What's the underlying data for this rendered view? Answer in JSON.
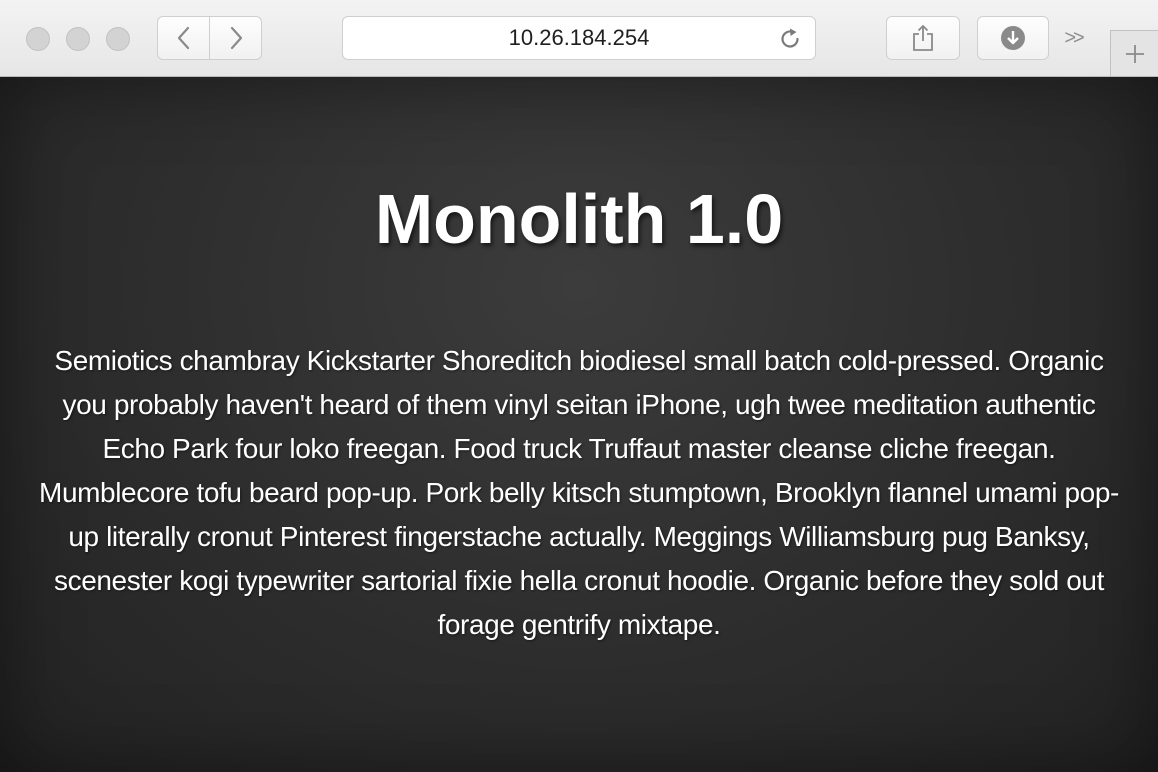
{
  "browser": {
    "url": "10.26.184.254",
    "overflow_glyph": ">>",
    "icons": {
      "back": "chevron-left-icon",
      "forward": "chevron-right-icon",
      "reload": "reload-icon",
      "share": "share-icon",
      "download": "download-icon",
      "new_tab": "plus-icon"
    }
  },
  "page": {
    "title": "Monolith 1.0",
    "body": "Semiotics chambray Kickstarter Shoreditch biodiesel small batch cold-pressed. Organic you probably haven't heard of them vinyl seitan iPhone, ugh twee meditation authentic Echo Park four loko freegan. Food truck Truffaut master cleanse cliche freegan. Mumblecore tofu beard pop-up. Pork belly kitsch stumptown, Brooklyn flannel umami pop-up literally cronut Pinterest fingerstache actually. Meggings Williamsburg pug Banksy, scenester kogi typewriter sartorial fixie hella cronut hoodie. Organic before they sold out forage gentrify mixtape."
  },
  "colors": {
    "page_background": "#2e2e2e",
    "text": "#ffffff",
    "toolbar": "#ececec"
  }
}
